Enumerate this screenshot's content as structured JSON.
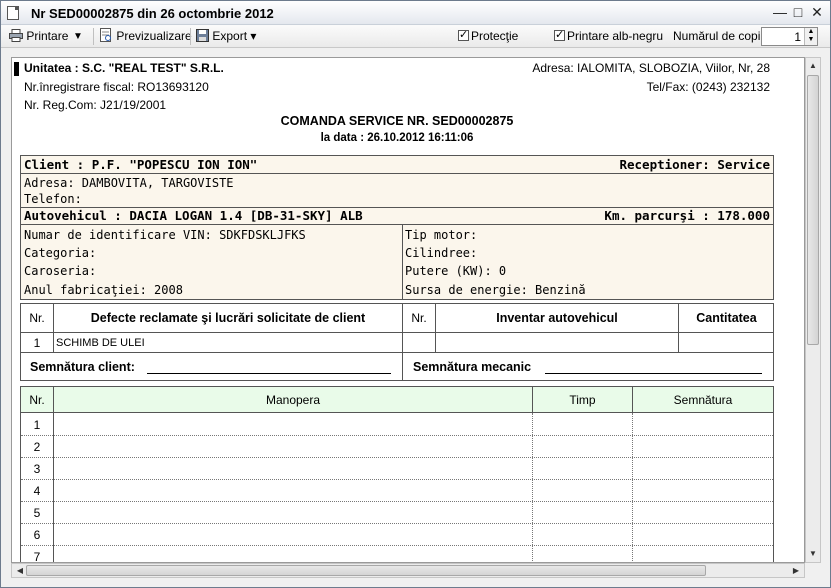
{
  "window": {
    "title": "Nr SED00002875 din 26 octombrie 2012",
    "minimize": "—",
    "maximize": "□",
    "close": "✕"
  },
  "toolbar": {
    "print_label": "Printare",
    "print_dropdown": "▼",
    "preview_label": "Previzualizare",
    "export_label": "Export",
    "export_dropdown": "▾",
    "protection_label": "Protecţie",
    "protection_checked": true,
    "bw_label": "Printare alb-negru",
    "bw_checked": true,
    "copies_label": "Numărul de copii:",
    "copies_value": "1"
  },
  "document": {
    "company": "Unitatea : S.C. \"REAL TEST\" S.R.L.",
    "fiscal": "Nr.înregistrare fiscal: RO13693120",
    "regcom": "Nr. Reg.Com: J21/19/2001",
    "address": "Adresa: IALOMITA, SLOBOZIA, Viilor, Nr, 28",
    "telfax": "Tel/Fax:  (0243) 232132",
    "doc_title": "COMANDA SERVICE NR. SED00002875",
    "doc_date": "la data : 26.10.2012 16:11:06",
    "client": {
      "name": "Client : P.F. \"POPESCU ION ION\"",
      "receptioner": "Receptioner: Service",
      "address": "Adresa: DAMBOVITA, TARGOVISTE",
      "phone": "Telefon:"
    },
    "vehicle": {
      "title": "Autovehicul : DACIA LOGAN 1.4 [DB-31-SKY] ALB",
      "km": "Km. parcurşi : 178.000",
      "vin": "Numar de identificare VIN: SDKFDSKLJFKS",
      "category": "Categoria:",
      "body": "Caroseria:",
      "year": "Anul fabricaţiei: 2008",
      "engine_type": "Tip motor:",
      "displacement": "Cilindree:",
      "power": "Putere (KW): 0",
      "energy": "Sursa de energie: Benzină"
    },
    "defects": {
      "col_nr": "Nr.",
      "col_desc": "Defecte reclamate şi lucrări solicitate de client",
      "rows": [
        {
          "nr": "1",
          "desc": "SCHIMB DE ULEI"
        }
      ]
    },
    "inventory": {
      "col_nr": "Nr.",
      "col_item": "Inventar autovehicul",
      "col_qty": "Cantitatea"
    },
    "signature_client": "Semnătura client:",
    "signature_mechanic": "Semnătura mecanic",
    "labor": {
      "col_nr": "Nr.",
      "col_labor": "Manopera",
      "col_time": "Timp",
      "col_sign": "Semnătura",
      "rows": [
        "1",
        "2",
        "3",
        "4",
        "5",
        "6",
        "7"
      ]
    }
  },
  "icons": {
    "printer": "printer-icon",
    "preview": "preview-icon",
    "export": "save-icon"
  }
}
